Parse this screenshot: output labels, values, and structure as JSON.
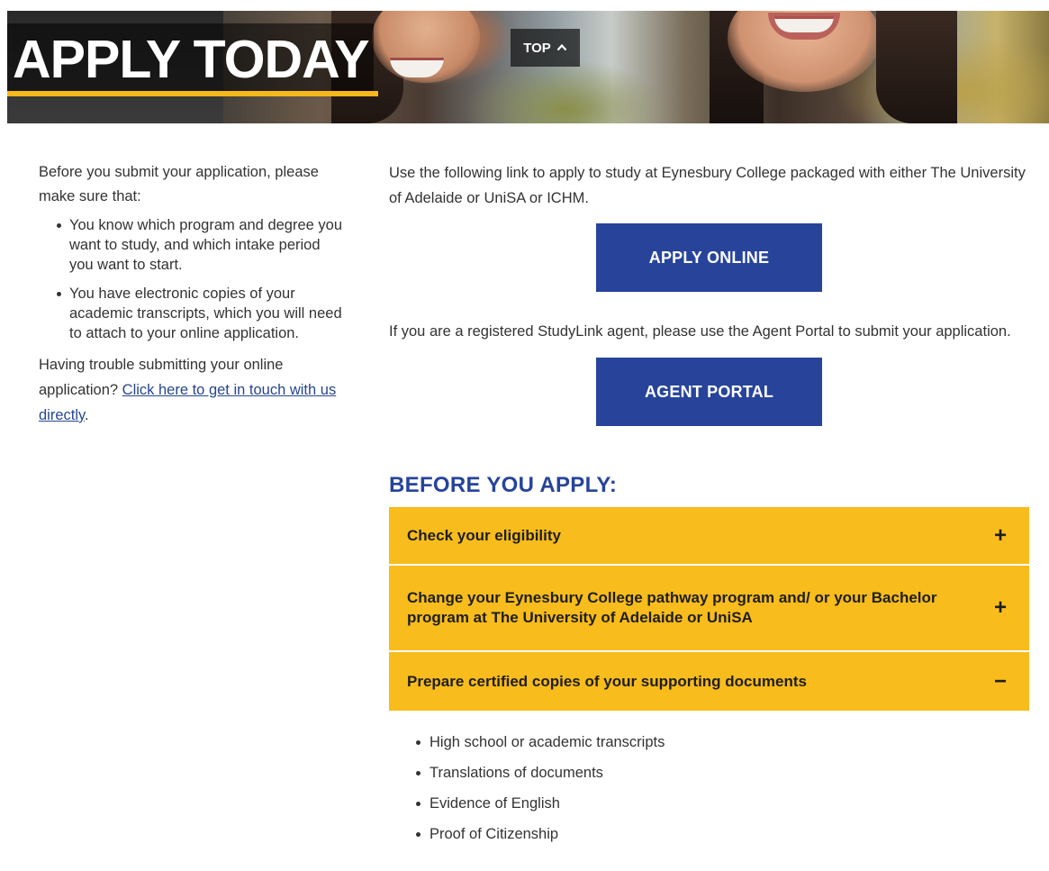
{
  "hero": {
    "title": "APPLY TODAY",
    "top_label": "TOP",
    "top_icon": "chevron-up-icon"
  },
  "left": {
    "intro": "Before you submit your application, please make sure that:",
    "bullets": [
      "You know which program and degree you want to study, and which intake period you want to start.",
      "You have electronic copies of your academic transcripts, which you will need to attach to your online application."
    ],
    "trouble_prefix": "Having trouble submitting your online application? ",
    "trouble_link": "Click here to get in touch with us directly",
    "trouble_suffix": "."
  },
  "right": {
    "apply_text": "Use the following link to apply to study at Eynesbury College packaged with either The University of Adelaide or UniSA or ICHM.",
    "apply_button": "APPLY ONLINE",
    "agent_text": "If you are a registered StudyLink agent, please use the Agent Portal to submit your application.",
    "agent_button": "AGENT PORTAL",
    "section_title": "BEFORE YOU APPLY:",
    "accordion": [
      {
        "label": "Check your eligibility",
        "sign": "+"
      },
      {
        "label": "Change your Eynesbury College pathway program and/ or your Bachelor program at The University of Adelaide or UniSA",
        "sign": "+"
      },
      {
        "label": "Prepare certified copies of your supporting documents",
        "sign": "−"
      }
    ],
    "documents": [
      "High school or academic transcripts",
      "Translations of documents",
      "Evidence of English",
      "Proof of Citizenship"
    ]
  },
  "colors": {
    "brand_blue": "#27449a",
    "accent_yellow": "#f8bc1c",
    "link_blue": "#27468f"
  }
}
